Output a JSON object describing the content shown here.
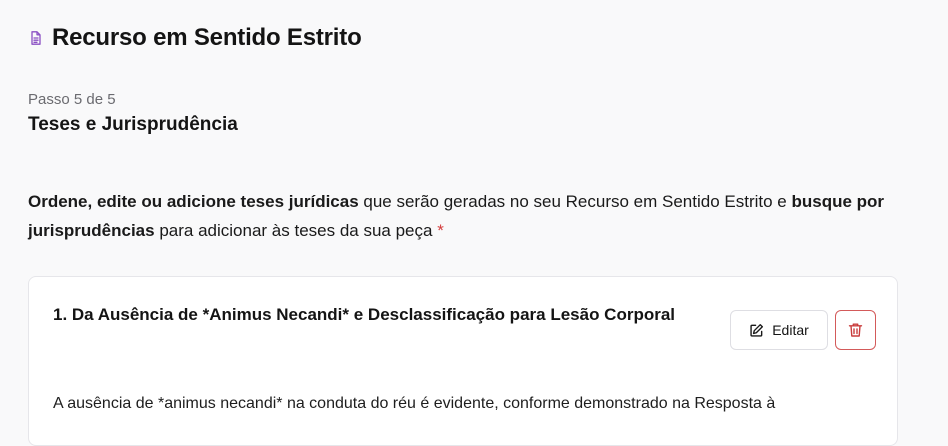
{
  "header": {
    "title": "Recurso em Sentido Estrito",
    "icon": "document-icon",
    "icon_color": "#8a4fc4"
  },
  "step": {
    "progress": "Passo 5 de 5",
    "title": "Teses e Jurisprudência"
  },
  "description": {
    "bold1": "Ordene, edite ou adicione teses jurídicas",
    "text1": " que serão geradas no seu Recurso em Sentido Estrito e ",
    "bold2": "busque por jurisprudências",
    "text2": " para adicionar às teses da sua peça ",
    "required_mark": "*"
  },
  "thesis": {
    "title": "1. Da Ausência de *Animus Necandi* e Desclassificação para Lesão Corporal",
    "body": "A ausência de *animus necandi* na conduta do réu é evidente, conforme demonstrado na Resposta à",
    "edit_label": "Editar",
    "edit_icon": "edit-icon",
    "delete_icon": "trash-icon",
    "delete_color": "#c93c3c"
  }
}
